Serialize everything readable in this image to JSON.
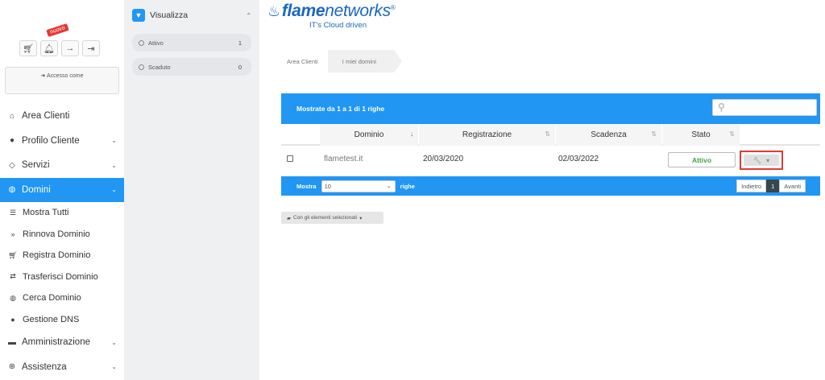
{
  "sidebar": {
    "new_badge": "nuovo",
    "login_as": "Accesso come",
    "nav": [
      {
        "label": "Area Clienti"
      },
      {
        "label": "Profilo Cliente"
      },
      {
        "label": "Servizi"
      },
      {
        "label": "Domini"
      }
    ],
    "sub": [
      {
        "label": "Mostra Tutti"
      },
      {
        "label": "Rinnova Dominio"
      },
      {
        "label": "Registra Dominio"
      },
      {
        "label": "Trasferisci Dominio"
      },
      {
        "label": "Cerca Dominio"
      },
      {
        "label": "Gestione DNS"
      }
    ],
    "nav_bottom": [
      {
        "label": "Amministrazione"
      },
      {
        "label": "Assistenza"
      }
    ]
  },
  "filter": {
    "title": "Visualizza",
    "items": [
      {
        "label": "Attivo",
        "count": "1"
      },
      {
        "label": "Scaduto",
        "count": "0"
      }
    ]
  },
  "brand": {
    "name_bold": "flame",
    "name_light": "networks",
    "reg": "®",
    "tagline": "IT's Cloud driven"
  },
  "breadcrumb": [
    "Area Clienti",
    "I miei domini"
  ],
  "table": {
    "info": "Mostrate da 1 a 1 di 1 righe",
    "columns": [
      "Dominio",
      "Registrazione",
      "Scadenza",
      "Stato"
    ],
    "rows": [
      {
        "domain": "flametest.it",
        "registration": "20/03/2020",
        "expiry": "02/03/2022",
        "status": "Attivo"
      }
    ],
    "length_prefix": "Mostra",
    "length_value": "10",
    "length_suffix": "righe",
    "prev": "Indietro",
    "page": "1",
    "next": "Avanti",
    "bulk": "Con gli elementi selezionati"
  },
  "colors": {
    "accent": "#2196f3",
    "status_active": "#43a047",
    "highlight": "#e53935"
  }
}
